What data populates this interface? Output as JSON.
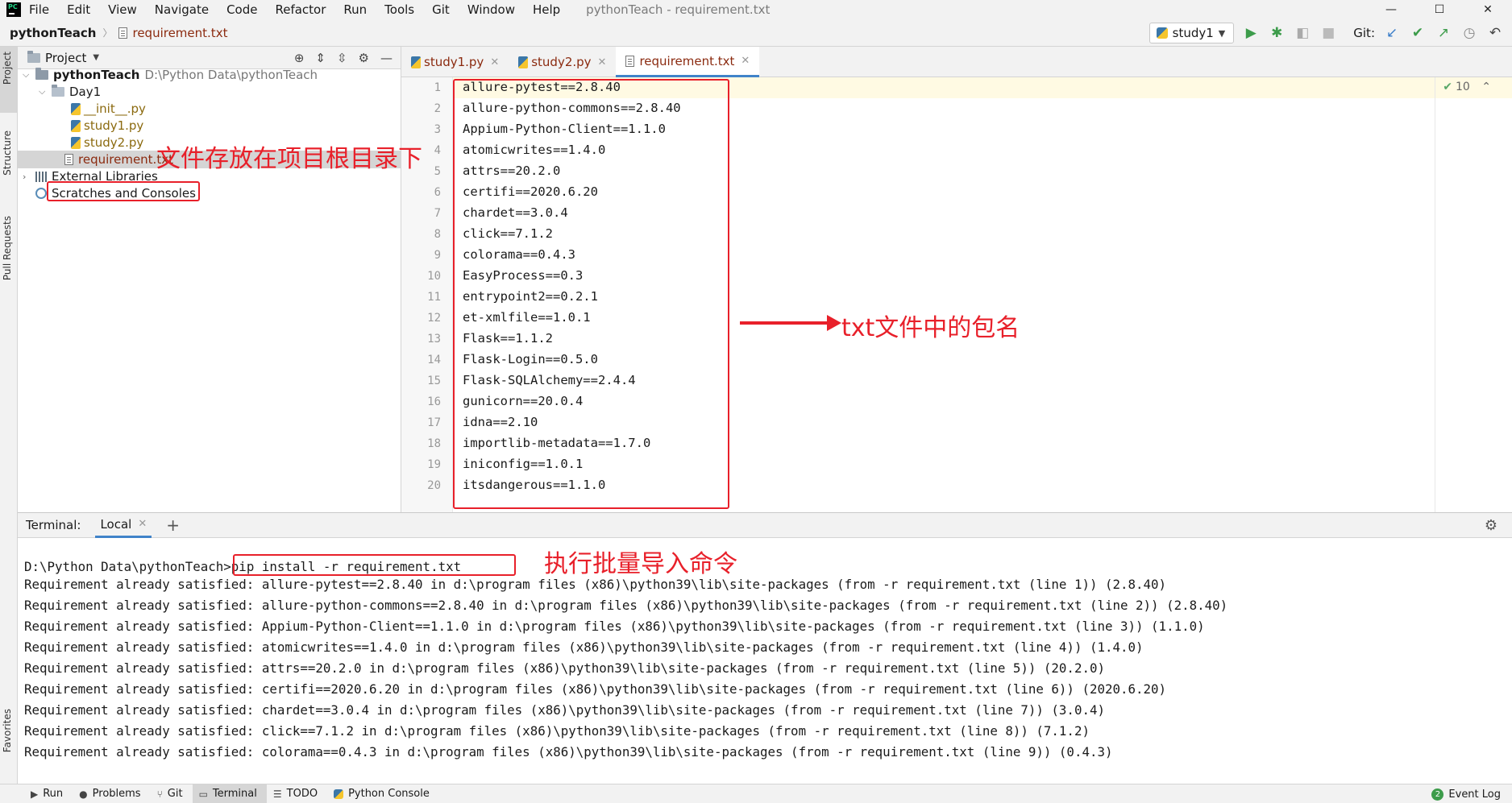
{
  "menubar": {
    "logo": "PC",
    "items": [
      "File",
      "Edit",
      "View",
      "Navigate",
      "Code",
      "Refactor",
      "Run",
      "Tools",
      "Git",
      "Window",
      "Help"
    ],
    "window_title": "pythonTeach - requirement.txt"
  },
  "navbar": {
    "project": "pythonTeach",
    "file": "requirement.txt",
    "run_config": "study1",
    "git_label": "Git:"
  },
  "left_strip": {
    "tabs": [
      "Project",
      "Structure",
      "Pull Requests",
      "Favorites"
    ]
  },
  "project_panel": {
    "title": "Project",
    "root_name": "pythonTeach",
    "root_path": "D:\\Python Data\\pythonTeach",
    "folder": "Day1",
    "files": [
      "__init__.py",
      "study1.py",
      "study2.py"
    ],
    "selected_file": "requirement.txt",
    "external_libraries": "External Libraries",
    "scratches": "Scratches and Consoles"
  },
  "editor": {
    "tabs": [
      "study1.py",
      "study2.py",
      "requirement.txt"
    ],
    "inspection_count": "10",
    "lines": [
      "allure-pytest==2.8.40",
      "allure-python-commons==2.8.40",
      "Appium-Python-Client==1.1.0",
      "atomicwrites==1.4.0",
      "attrs==20.2.0",
      "certifi==2020.6.20",
      "chardet==3.0.4",
      "click==7.1.2",
      "colorama==0.4.3",
      "EasyProcess==0.3",
      "entrypoint2==0.2.1",
      "et-xmlfile==1.0.1",
      "Flask==1.1.2",
      "Flask-Login==0.5.0",
      "Flask-SQLAlchemy==2.4.4",
      "gunicorn==20.0.4",
      "idna==2.10",
      "importlib-metadata==1.7.0",
      "iniconfig==1.0.1",
      "itsdangerous==1.1.0"
    ],
    "line_numbers": [
      "1",
      "2",
      "3",
      "4",
      "5",
      "6",
      "7",
      "8",
      "9",
      "10",
      "11",
      "12",
      "13",
      "14",
      "15",
      "16",
      "17",
      "18",
      "19",
      "20"
    ]
  },
  "terminal": {
    "label": "Terminal:",
    "tab": "Local",
    "prompt": "D:\\Python Data\\pythonTeach>",
    "command": "pip install -r requirement.txt",
    "output": [
      "Requirement already satisfied: allure-pytest==2.8.40 in d:\\program files (x86)\\python39\\lib\\site-packages (from -r requirement.txt (line 1)) (2.8.40)",
      "Requirement already satisfied: allure-python-commons==2.8.40 in d:\\program files (x86)\\python39\\lib\\site-packages (from -r requirement.txt (line 2)) (2.8.40)",
      "Requirement already satisfied: Appium-Python-Client==1.1.0 in d:\\program files (x86)\\python39\\lib\\site-packages (from -r requirement.txt (line 3)) (1.1.0)",
      "Requirement already satisfied: atomicwrites==1.4.0 in d:\\program files (x86)\\python39\\lib\\site-packages (from -r requirement.txt (line 4)) (1.4.0)",
      "Requirement already satisfied: attrs==20.2.0 in d:\\program files (x86)\\python39\\lib\\site-packages (from -r requirement.txt (line 5)) (20.2.0)",
      "Requirement already satisfied: certifi==2020.6.20 in d:\\program files (x86)\\python39\\lib\\site-packages (from -r requirement.txt (line 6)) (2020.6.20)",
      "Requirement already satisfied: chardet==3.0.4 in d:\\program files (x86)\\python39\\lib\\site-packages (from -r requirement.txt (line 7)) (3.0.4)",
      "Requirement already satisfied: click==7.1.2 in d:\\program files (x86)\\python39\\lib\\site-packages (from -r requirement.txt (line 8)) (7.1.2)",
      "Requirement already satisfied: colorama==0.4.3 in d:\\program files (x86)\\python39\\lib\\site-packages (from -r requirement.txt (line 9)) (0.4.3)"
    ]
  },
  "statusbar": {
    "items": [
      "Run",
      "Problems",
      "Git",
      "Terminal",
      "TODO",
      "Python Console"
    ],
    "event_log": "Event Log",
    "event_count": "2"
  },
  "annotations": {
    "project_root": "文件存放在项目根目录下",
    "package_names": "txt文件中的包名",
    "batch_command": "执行批量导入命令"
  },
  "colors": {
    "annotation": "#e8202a",
    "accent": "#4083c9",
    "file_modified": "#8b2a0f"
  }
}
